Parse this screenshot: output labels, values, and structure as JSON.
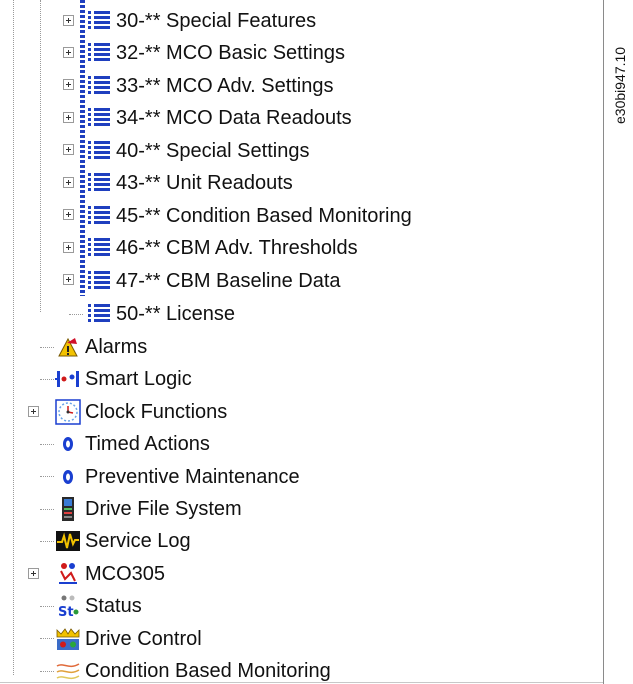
{
  "tree": {
    "parameter_groups": [
      {
        "label": "30-** Special Features",
        "expandable": true
      },
      {
        "label": "32-** MCO Basic Settings",
        "expandable": true
      },
      {
        "label": "33-** MCO Adv. Settings",
        "expandable": true
      },
      {
        "label": "34-** MCO Data Readouts",
        "expandable": true
      },
      {
        "label": "40-** Special Settings",
        "expandable": true
      },
      {
        "label": "43-** Unit Readouts",
        "expandable": true
      },
      {
        "label": "45-** Condition Based Monitoring",
        "expandable": true
      },
      {
        "label": "46-** CBM Adv. Thresholds",
        "expandable": true
      },
      {
        "label": "47-** CBM Baseline Data",
        "expandable": true
      },
      {
        "label": "50-** License",
        "expandable": false
      }
    ],
    "top_level": [
      {
        "label": "Alarms",
        "icon": "alarm-bell-icon",
        "expandable": false
      },
      {
        "label": "Smart Logic",
        "icon": "smart-logic-icon",
        "expandable": false
      },
      {
        "label": "Clock Functions",
        "icon": "clock-icon",
        "expandable": true
      },
      {
        "label": "Timed Actions",
        "icon": "timed-actions-icon",
        "expandable": false
      },
      {
        "label": "Preventive Maintenance",
        "icon": "preventive-maintenance-icon",
        "expandable": false
      },
      {
        "label": "Drive File System",
        "icon": "file-system-icon",
        "expandable": false
      },
      {
        "label": "Service Log",
        "icon": "service-log-icon",
        "expandable": false
      },
      {
        "label": "MCO305",
        "icon": "mco-icon",
        "expandable": true
      },
      {
        "label": "Status",
        "icon": "status-icon",
        "expandable": false
      },
      {
        "label": "Drive Control",
        "icon": "drive-control-icon",
        "expandable": false
      },
      {
        "label": "Condition Based Monitoring",
        "icon": "cbm-icon",
        "expandable": false
      }
    ]
  },
  "figure_id": "e30bi947.10",
  "colors": {
    "list_icon": "#1f3fbf",
    "tree_line": "#9a9a9a"
  }
}
